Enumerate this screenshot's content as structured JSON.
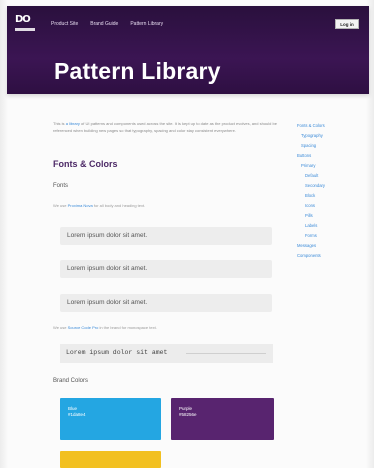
{
  "header": {
    "logo_text": "DO",
    "nav": [
      "Product Site",
      "Brand Guide",
      "Pattern Library"
    ],
    "button_label": "Log in",
    "title": "Pattern Library"
  },
  "intro": {
    "text_a": "This is",
    "link": "a library",
    "text_b": "of UI patterns and components used across the site. It is kept up to date as the product evolves, and should be referenced when building new pages so that typography, spacing and color stay consistent everywhere."
  },
  "section": {
    "heading": "Fonts & Colors",
    "fonts_heading": "Fonts",
    "fonts_note_a": "We use",
    "fonts_note_link": "Proxima Nova",
    "fonts_note_b": "for all body and heading text.",
    "samples": [
      "Lorem ipsum dolor sit amet.",
      "Lorem ipsum dolor sit amet.",
      "Lorem ipsum dolor sit amet."
    ],
    "mono_note_a": "We use",
    "mono_note_link": "Source Code Pro",
    "mono_note_b": "in the brand for monospace text.",
    "mono_sample": "Lorem ipsum dolor sit amet",
    "brand_heading": "Brand Colors",
    "swatches": [
      {
        "label": "Blue",
        "sub": "#1da8e4",
        "color": "#24a6e2"
      },
      {
        "label": "Purple",
        "sub": "#58256e",
        "color": "#58246f"
      },
      {
        "label": "",
        "sub": "",
        "color": "#f2c020"
      }
    ]
  },
  "sidebar": {
    "items": [
      {
        "label": "Fonts & Colors",
        "level": 0
      },
      {
        "label": "Typography",
        "level": 1
      },
      {
        "label": "Spacing",
        "level": 1
      },
      {
        "label": "Buttons",
        "level": 0
      },
      {
        "label": "Primary",
        "level": 1
      },
      {
        "label": "Default",
        "level": 2
      },
      {
        "label": "Secondary",
        "level": 2
      },
      {
        "label": "Block",
        "level": 2
      },
      {
        "label": "Icons",
        "level": 2
      },
      {
        "label": "Pills",
        "level": 2
      },
      {
        "label": "Labels",
        "level": 2
      },
      {
        "label": "Forms",
        "level": 2
      },
      {
        "label": "Messages",
        "level": 0
      },
      {
        "label": "Components",
        "level": 0
      }
    ]
  }
}
